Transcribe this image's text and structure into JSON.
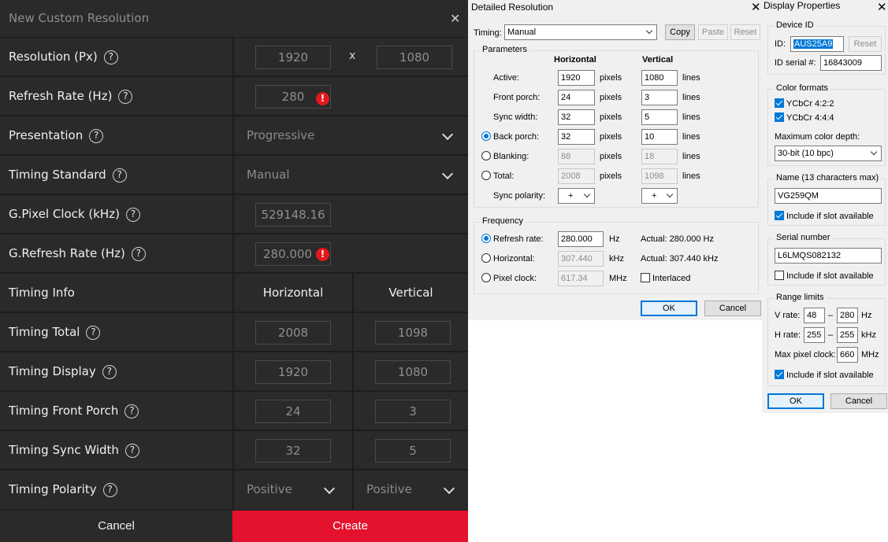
{
  "amd": {
    "title": "New Custom Resolution",
    "close_glyph": "✕",
    "rows": {
      "resolution": {
        "label": "Resolution (Px)",
        "h": "1920",
        "sep": "x",
        "v": "1080"
      },
      "refresh": {
        "label": "Refresh Rate (Hz)",
        "value": "280"
      },
      "presentation": {
        "label": "Presentation",
        "value": "Progressive"
      },
      "timing_standard": {
        "label": "Timing Standard",
        "value": "Manual"
      },
      "gpixel": {
        "label": "G.Pixel Clock (kHz)",
        "value": "529148.16"
      },
      "grefresh": {
        "label": "G.Refresh Rate (Hz)",
        "value": "280.000"
      },
      "timing_info": {
        "label": "Timing Info",
        "h": "Horizontal",
        "v": "Vertical"
      },
      "timing_total": {
        "label": "Timing Total",
        "h": "2008",
        "v": "1098"
      },
      "timing_display": {
        "label": "Timing Display",
        "h": "1920",
        "v": "1080"
      },
      "timing_front": {
        "label": "Timing Front Porch",
        "h": "24",
        "v": "3"
      },
      "timing_sync": {
        "label": "Timing Sync Width",
        "h": "32",
        "v": "5"
      },
      "timing_polarity": {
        "label": "Timing Polarity",
        "h": "Positive",
        "v": "Positive"
      }
    },
    "help_glyph": "?",
    "error_glyph": "!",
    "cancel": "Cancel",
    "create": "Create",
    "colors": {
      "background": "#2a2a2a",
      "accent": "#e4122c",
      "error": "#e4181c"
    }
  },
  "detailed": {
    "title": "Detailed Resolution",
    "timing_label": "Timing:",
    "timing_value": "Manual",
    "copy": "Copy",
    "paste": "Paste",
    "reset": "Reset",
    "params_title": "Parameters",
    "col_h": "Horizontal",
    "col_v": "Vertical",
    "rows": [
      {
        "label": "Active:",
        "h": "1920",
        "hu": "pixels",
        "v": "1080",
        "vu": "lines"
      },
      {
        "label": "Front porch:",
        "h": "24",
        "hu": "pixels",
        "v": "3",
        "vu": "lines"
      },
      {
        "label": "Sync width:",
        "h": "32",
        "hu": "pixels",
        "v": "5",
        "vu": "lines"
      },
      {
        "label": "Back porch:",
        "h": "32",
        "hu": "pixels",
        "v": "10",
        "vu": "lines"
      },
      {
        "label": "Blanking:",
        "h": "88",
        "hu": "pixels",
        "v": "18",
        "vu": "lines"
      },
      {
        "label": "Total:",
        "h": "2008",
        "hu": "pixels",
        "v": "1098",
        "vu": "lines"
      }
    ],
    "sync_label": "Sync polarity:",
    "sync_h": "+",
    "sync_v": "+",
    "freq_title": "Frequency",
    "refresh_label": "Refresh rate:",
    "refresh_value": "280.000",
    "refresh_unit": "Hz",
    "refresh_actual": "Actual: 280.000 Hz",
    "horiz_label": "Horizontal:",
    "horiz_value": "307.440",
    "horiz_unit": "kHz",
    "horiz_actual": "Actual: 307.440 kHz",
    "pixel_label": "Pixel clock:",
    "pixel_value": "617.34",
    "pixel_unit": "MHz",
    "interlaced": "Interlaced",
    "ok": "OK",
    "cancel": "Cancel"
  },
  "props": {
    "title": "Display Properties",
    "device_title": "Device ID",
    "id_label": "ID:",
    "id_value": "AUS25A9",
    "reset": "Reset",
    "serial_label": "ID serial #:",
    "serial_value": "16843009",
    "color_title": "Color formats",
    "ycbcr422": "YCbCr 4:2:2",
    "ycbcr444": "YCbCr 4:4:4",
    "depth_label": "Maximum color depth:",
    "depth_value": "30-bit (10 bpc)",
    "name_title": "Name (13 characters max)",
    "name_value": "VG259QM",
    "include1": "Include if slot available",
    "sn_title": "Serial number",
    "sn_value": "L6LMQS082132",
    "include2": "Include if slot available",
    "range_title": "Range limits",
    "vrate_label": "V rate:",
    "vrate_min": "48",
    "dash": "–",
    "vrate_max": "280",
    "vrate_unit": "Hz",
    "hrate_label": "H rate:",
    "hrate_min": "255",
    "hrate_max": "255",
    "hrate_unit": "kHz",
    "maxpix_label": "Max pixel clock:",
    "maxpix_value": "660",
    "maxpix_unit": "MHz",
    "include3": "Include if slot available",
    "ok": "OK",
    "cancel": "Cancel"
  },
  "close_glyph": "✕"
}
